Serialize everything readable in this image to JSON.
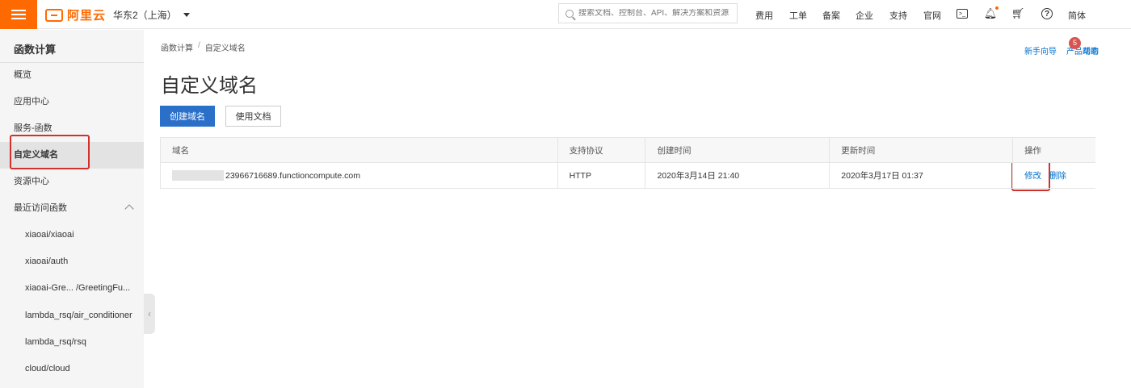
{
  "topbar": {
    "logo_text": "阿里云",
    "region": "华东2（上海）",
    "search_placeholder": "搜索文档、控制台、API、解决方案和资源",
    "links": [
      "费用",
      "工单",
      "备案",
      "企业",
      "支持",
      "官网"
    ],
    "language": "简体",
    "accent_color": "#ff6a00"
  },
  "sidebar": {
    "title": "函数计算",
    "items": [
      "概览",
      "应用中心",
      "服务-函数",
      "自定义域名",
      "资源中心",
      "最近访问函数"
    ],
    "recent": [
      "xiaoai/xiaoai",
      "xiaoai/auth",
      "xiaoai-Gre... /GreetingFu...",
      "lambda_rsq/air_conditioner",
      "lambda_rsq/rsq",
      "cloud/cloud"
    ]
  },
  "main": {
    "breadcrumb": [
      "函数计算",
      "自定义域名"
    ],
    "breadcrumb_sep": "/",
    "top_links": [
      "新手向导",
      "产品动态"
    ],
    "notification_count": "5",
    "help_link": "帮助",
    "page_title": "自定义域名",
    "create_button": "创建域名",
    "docs_button": "使用文档",
    "table": {
      "headers": [
        "域名",
        "支持协议",
        "创建时间",
        "更新时间",
        "操作"
      ],
      "rows": [
        {
          "domain": "23966716689.functioncompute.com",
          "protocol": "HTTP",
          "created": "2020年3月14日 21:40",
          "updated": "2020年3月17日 01:37",
          "actions": [
            "修改",
            "删除"
          ]
        }
      ]
    }
  }
}
